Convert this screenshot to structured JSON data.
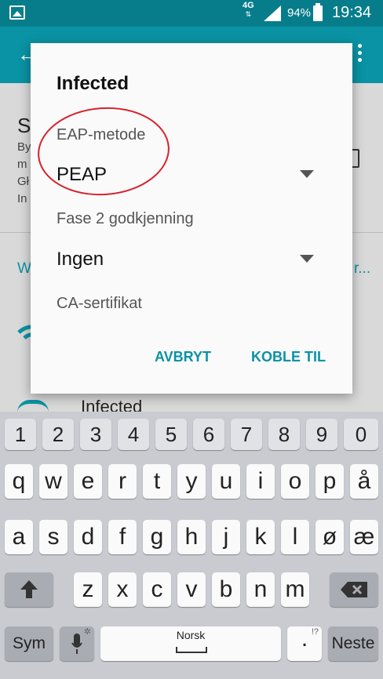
{
  "status_bar": {
    "network": "4G",
    "battery": "94%",
    "time": "19:34"
  },
  "background": {
    "section_letter": "S",
    "lines": [
      "By",
      "m",
      "Gł",
      "In"
    ],
    "link_left": "W",
    "link_right": "r...",
    "network_name": "Infected"
  },
  "dialog": {
    "title": "Infected",
    "eap_label": "EAP-metode",
    "eap_value": "PEAP",
    "phase2_label": "Fase 2 godkjenning",
    "phase2_value": "Ingen",
    "ca_label": "CA-sertifikat",
    "cancel": "AVBRYT",
    "connect": "KOBLE TIL"
  },
  "keyboard": {
    "numbers": [
      "1",
      "2",
      "3",
      "4",
      "5",
      "6",
      "7",
      "8",
      "9",
      "0"
    ],
    "row1": [
      "q",
      "w",
      "e",
      "r",
      "t",
      "y",
      "u",
      "i",
      "o",
      "p",
      "å"
    ],
    "row2": [
      "a",
      "s",
      "d",
      "f",
      "g",
      "h",
      "j",
      "k",
      "l",
      "ø",
      "æ"
    ],
    "row3": [
      "z",
      "x",
      "c",
      "v",
      "b",
      "n",
      "m"
    ],
    "sym": "Sym",
    "space_language": "Norsk",
    "period": ".",
    "period_hint": "!?",
    "next": "Neste"
  },
  "icons": {
    "gallery": "gallery-icon",
    "signal": "signal-icon",
    "battery": "battery-icon",
    "back": "back-arrow-icon",
    "menu": "more-vert-icon",
    "wifi": "wifi-icon",
    "dropdown": "dropdown-arrow-icon",
    "shift": "shift-icon",
    "backspace": "backspace-icon",
    "microphone": "microphone-icon"
  },
  "colors": {
    "status_bar": "#077d8c",
    "app_bar": "#0a93a4",
    "accent": "#0a93a4",
    "annotation_circle": "#d8202a"
  }
}
